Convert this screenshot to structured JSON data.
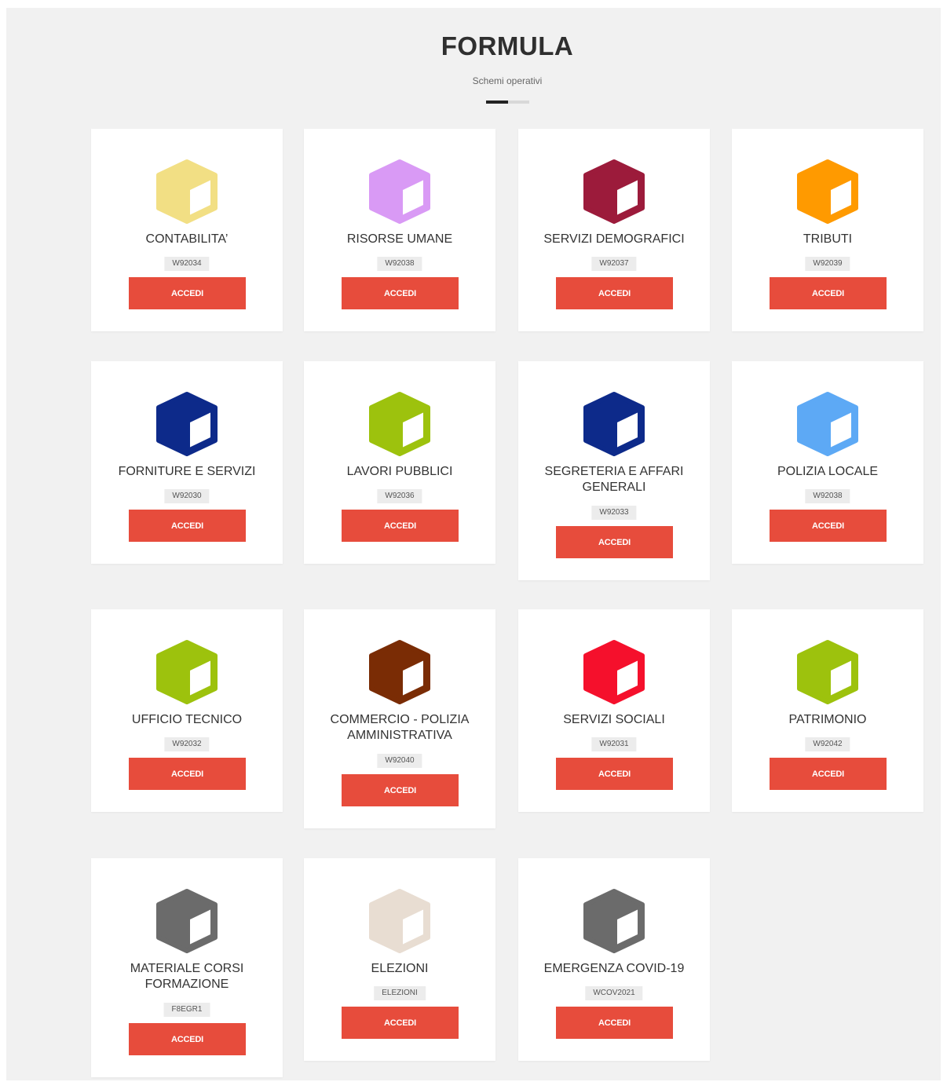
{
  "header": {
    "title": "FORMULA",
    "subtitle": "Schemi operativi"
  },
  "button_label": "ACCEDI",
  "colors": {
    "accedi_button": "#e74c3c",
    "page_background": "#f1f1f1"
  },
  "modules": [
    {
      "name": "CONTABILITA’",
      "code": "W92034",
      "color": "#f2df84"
    },
    {
      "name": "RISORSE UMANE",
      "code": "W92038",
      "color": "#d99af5"
    },
    {
      "name": "SERVIZI DEMOGRAFICI",
      "code": "W92037",
      "color": "#9c1b3b"
    },
    {
      "name": "TRIBUTI",
      "code": "W92039",
      "color": "#ff9a00"
    },
    {
      "name": "FORNITURE E SERVIZI",
      "code": "W92030",
      "color": "#0d2a8a"
    },
    {
      "name": "LAVORI PUBBLICI",
      "code": "W92036",
      "color": "#9dc20d"
    },
    {
      "name": "SEGRETERIA E AFFARI GENERALI",
      "code": "W92033",
      "color": "#0d2a8a"
    },
    {
      "name": "POLIZIA LOCALE",
      "code": "W92038",
      "color": "#5da9f5"
    },
    {
      "name": "UFFICIO TECNICO",
      "code": "W92032",
      "color": "#9dc20d"
    },
    {
      "name": "COMMERCIO - POLIZIA AMMINISTRATIVA",
      "code": "W92040",
      "color": "#7a2c05"
    },
    {
      "name": "SERVIZI SOCIALI",
      "code": "W92031",
      "color": "#f5102c"
    },
    {
      "name": "PATRIMONIO",
      "code": "W92042",
      "color": "#9dc20d"
    },
    {
      "name": "MATERIALE CORSI FORMAZIONE",
      "code": "F8EGR1",
      "color": "#6b6b6b"
    },
    {
      "name": "ELEZIONI",
      "code": "ELEZIONI",
      "color": "#e8ddd2"
    },
    {
      "name": "EMERGENZA COVID-19",
      "code": "WCOV2021",
      "color": "#6b6b6b"
    }
  ]
}
